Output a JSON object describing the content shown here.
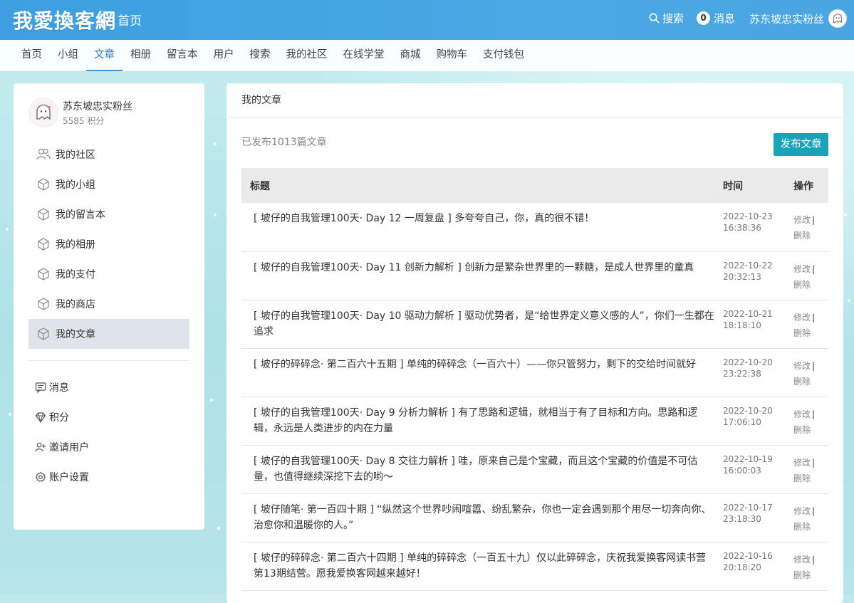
{
  "header": {
    "logo_text": "我愛換客網",
    "home_label": "首页",
    "search_label": "搜索",
    "messages_count": "0",
    "messages_label": "消息",
    "username": "苏东坡忠实粉丝"
  },
  "nav": {
    "items": [
      {
        "label": "首页"
      },
      {
        "label": "小组"
      },
      {
        "label": "文章"
      },
      {
        "label": "相册"
      },
      {
        "label": "留言本"
      },
      {
        "label": "用户"
      },
      {
        "label": "搜索"
      },
      {
        "label": "我的社区"
      },
      {
        "label": "在线学堂"
      },
      {
        "label": "商城"
      },
      {
        "label": "购物车"
      },
      {
        "label": "支付钱包"
      }
    ],
    "active_index": 2
  },
  "sidebar": {
    "username": "苏东坡忠实粉丝",
    "points": "5585 积分",
    "items": [
      {
        "label": "我的社区",
        "icon": "users-icon"
      },
      {
        "label": "我的小组",
        "icon": "cube-icon"
      },
      {
        "label": "我的留言本",
        "icon": "cube-icon"
      },
      {
        "label": "我的相册",
        "icon": "cube-icon"
      },
      {
        "label": "我的支付",
        "icon": "cube-icon"
      },
      {
        "label": "我的商店",
        "icon": "cube-icon"
      },
      {
        "label": "我的文章",
        "icon": "cube-icon"
      }
    ],
    "active_index": 6,
    "items2": [
      {
        "label": "消息",
        "icon": "message-icon"
      },
      {
        "label": "积分",
        "icon": "diamond-icon"
      },
      {
        "label": "邀请用户",
        "icon": "user-plus-icon"
      },
      {
        "label": "账户设置",
        "icon": "gear-icon"
      }
    ]
  },
  "main": {
    "title": "我的文章",
    "published_count": "已发布1013篇文章",
    "publish_button": "发布文章",
    "table": {
      "headers": {
        "title": "标题",
        "time": "时间",
        "ops": "操作"
      },
      "edit_label": "修改",
      "delete_label": "删除",
      "separator": "|",
      "rows": [
        {
          "title": "[ 坡仔的自我管理100天· Day 12 一周复盘 ] 多夸夸自己，你，真的很不错！",
          "date": "2022-10-23",
          "time": "16:38:36"
        },
        {
          "title": "[ 坡仔的自我管理100天· Day 11 创新力解析 ] 创新力是繁杂世界里的一颗糖，是成人世界里的童真",
          "date": "2022-10-22",
          "time": "20:32:13"
        },
        {
          "title": "[ 坡仔的自我管理100天· Day 10 驱动力解析 ] 驱动优势者，是“给世界定义意义感的人”，你们一生都在追求",
          "date": "2022-10-21",
          "time": "18:18:10"
        },
        {
          "title": "[ 坡仔的碎碎念· 第二百六十五期 ] 单纯的碎碎念（一百六十）——你只管努力，剩下的交给时间就好",
          "date": "2022-10-20",
          "time": "23:22:38"
        },
        {
          "title": "[ 坡仔的自我管理100天· Day 9 分析力解析 ] 有了思路和逻辑，就相当于有了目标和方向。思路和逻辑，永远是人类进步的内在力量",
          "date": "2022-10-20",
          "time": "17:06:10"
        },
        {
          "title": "[ 坡仔的自我管理100天· Day 8 交往力解析 ] 哇，原来自己是个宝藏，而且这个宝藏的价值是不可估量，也值得继续深挖下去的哟～",
          "date": "2022-10-19",
          "time": "16:00:03"
        },
        {
          "title": "[ 坡仔随笔· 第一百四十期 ] “纵然这个世界吵闹喧嚣、纷乱繁杂，你也一定会遇到那个用尽一切奔向你、治愈你和温暖你的人。”",
          "date": "2022-10-17",
          "time": "23:18:30"
        },
        {
          "title": "[ 坡仔的碎碎念· 第二百六十四期 ] 单纯的碎碎念（一百五十九）仅以此碎碎念，庆祝我爱换客网读书营第13期结营。愿我爱换客网越来越好！",
          "date": "2022-10-16",
          "time": "20:18:20"
        }
      ]
    }
  }
}
